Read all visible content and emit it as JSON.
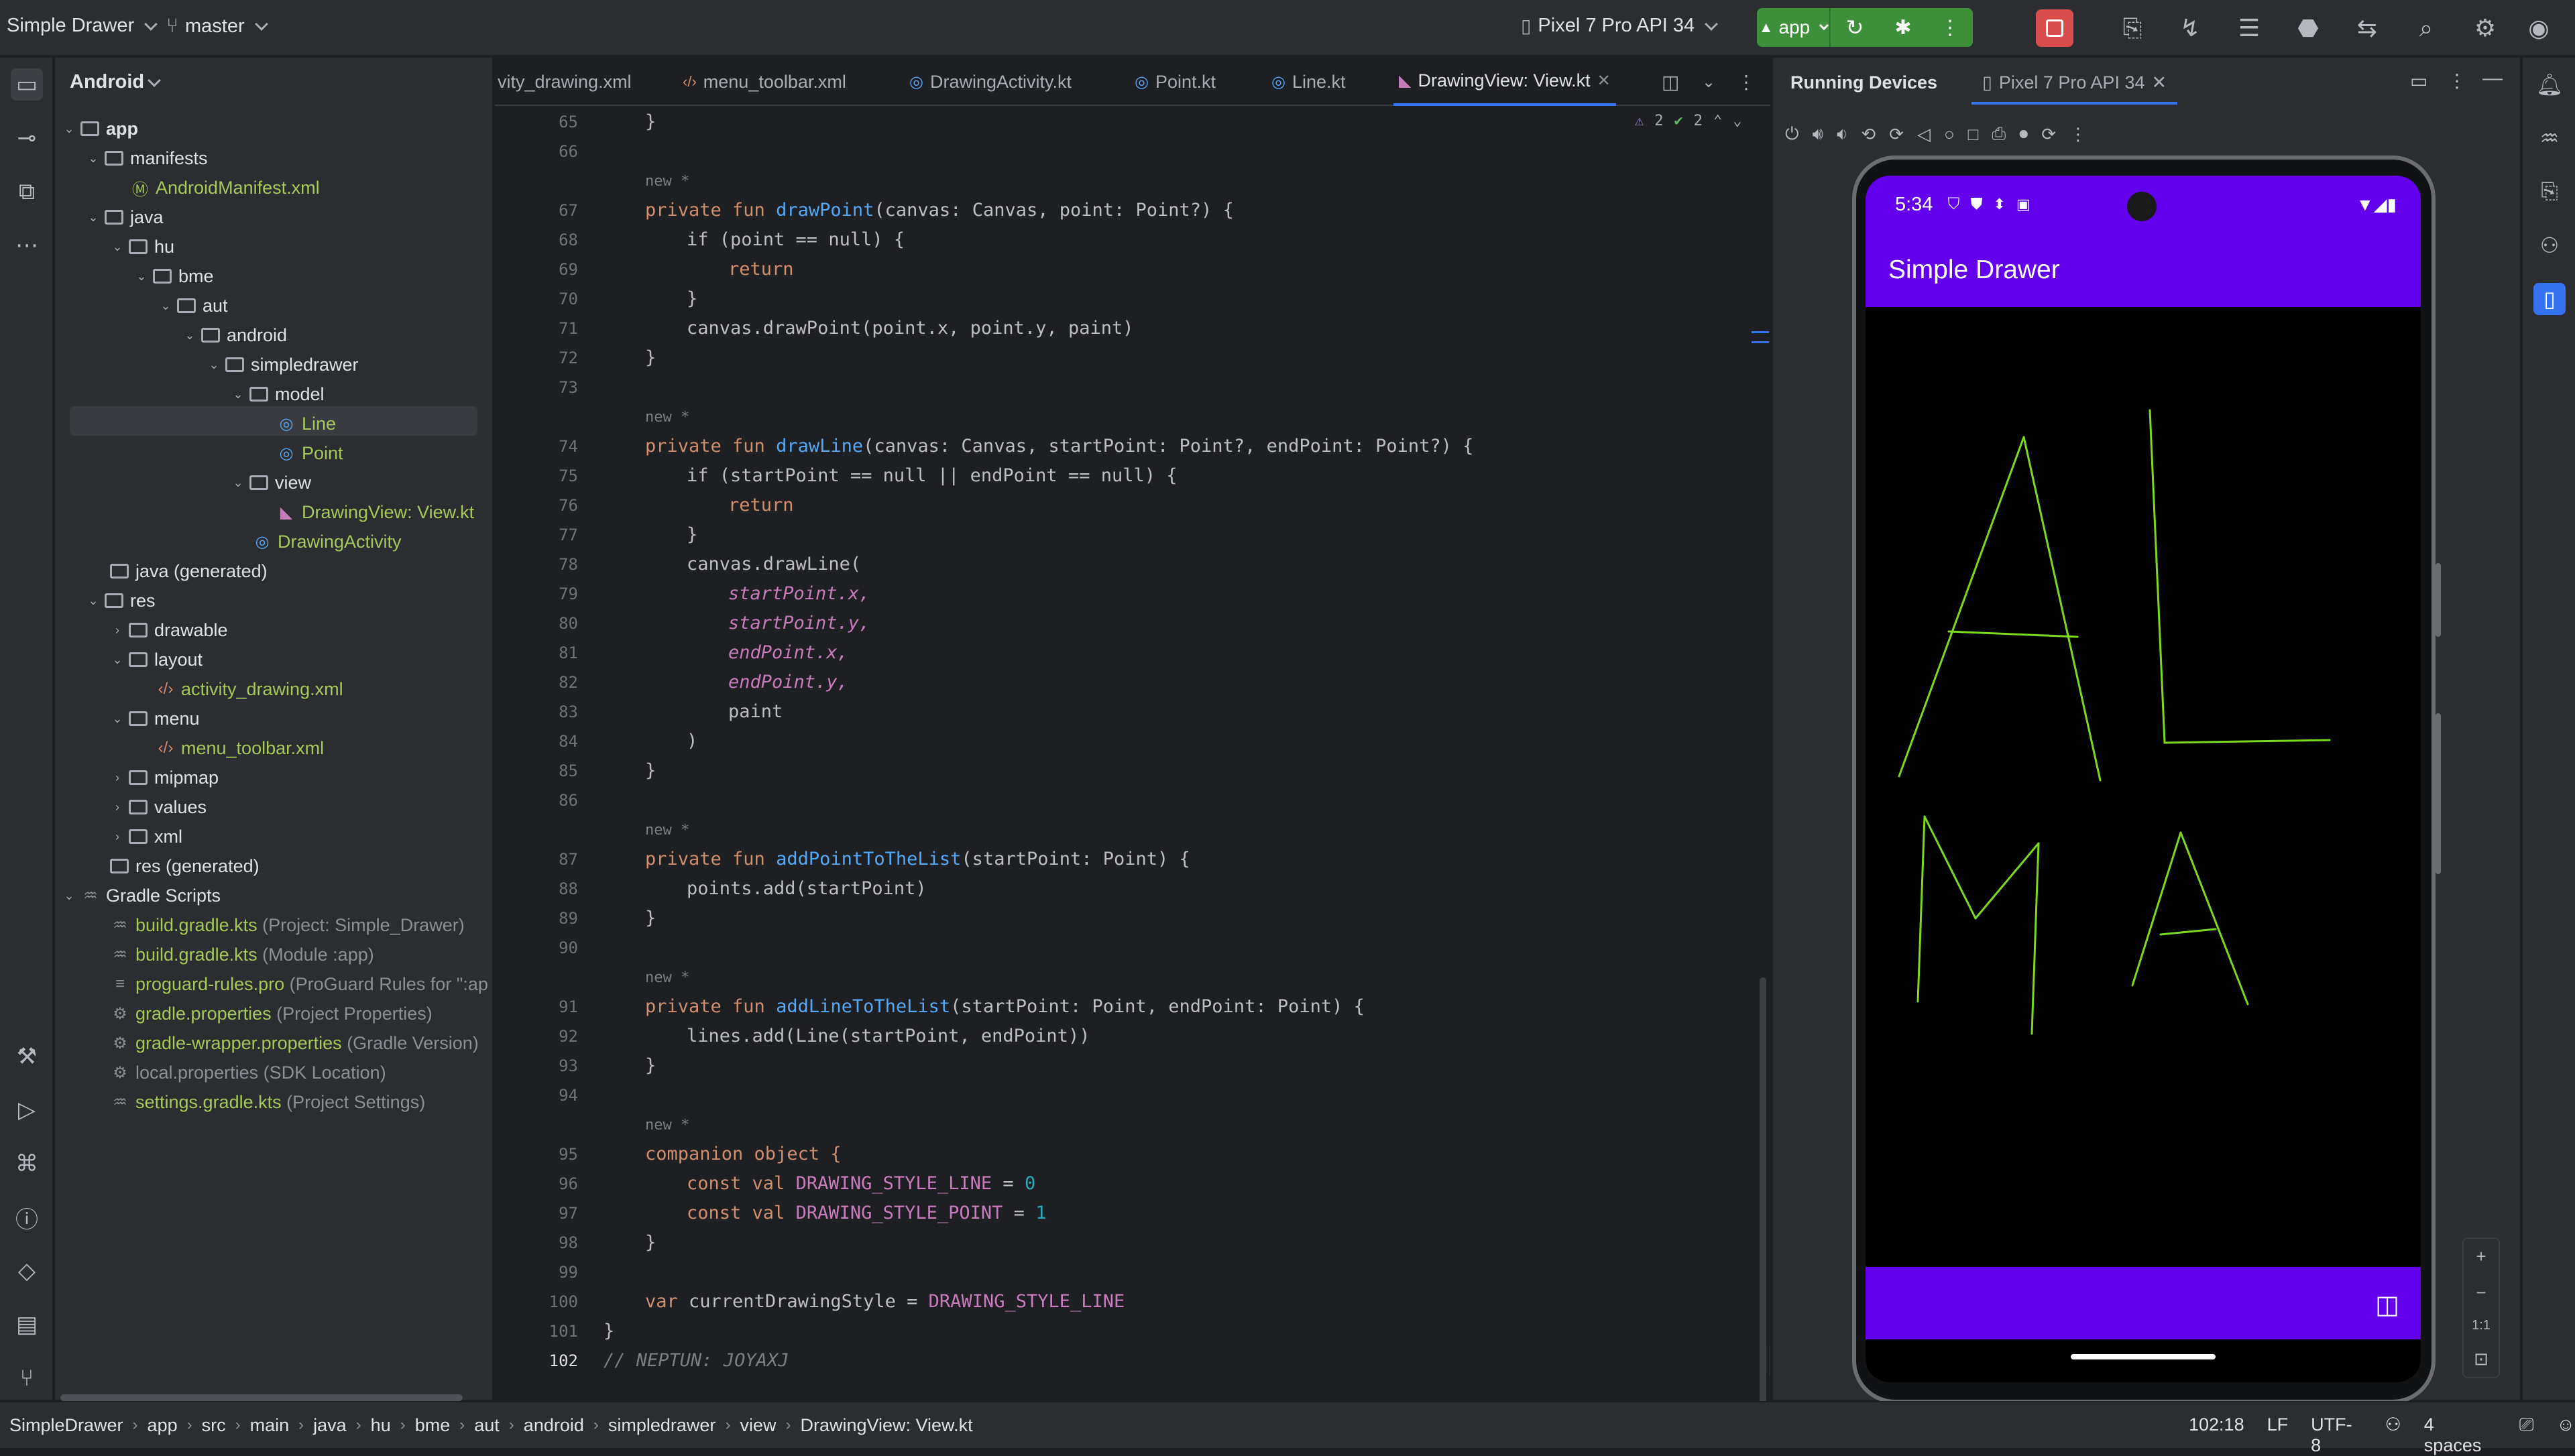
{
  "topbar": {
    "project": "Simple Drawer",
    "branch": "master",
    "device": "Pixel 7 Pro API 34",
    "run_config": "app"
  },
  "project_panel": {
    "view_mode": "Android",
    "tree": [
      {
        "label": "app",
        "bold": true
      },
      {
        "label": "manifests"
      },
      {
        "label": "AndroidManifest.xml"
      },
      {
        "label": "java"
      },
      {
        "label": "hu"
      },
      {
        "label": "bme"
      },
      {
        "label": "aut"
      },
      {
        "label": "android"
      },
      {
        "label": "simpledrawer"
      },
      {
        "label": "model"
      },
      {
        "label": "Line"
      },
      {
        "label": "Point"
      },
      {
        "label": "view"
      },
      {
        "label": "DrawingView: View.kt"
      },
      {
        "label": "DrawingActivity"
      },
      {
        "label": "java (generated)"
      },
      {
        "label": "res"
      },
      {
        "label": "drawable"
      },
      {
        "label": "layout"
      },
      {
        "label": "activity_drawing.xml"
      },
      {
        "label": "menu"
      },
      {
        "label": "menu_toolbar.xml"
      },
      {
        "label": "mipmap"
      },
      {
        "label": "values"
      },
      {
        "label": "xml"
      },
      {
        "label": "res (generated)"
      },
      {
        "label": "Gradle Scripts"
      },
      {
        "label": "build.gradle.kts",
        "note": "(Project: Simple_Drawer)"
      },
      {
        "label": "build.gradle.kts",
        "note": "(Module :app)"
      },
      {
        "label": "proguard-rules.pro",
        "note": "(ProGuard Rules for \":ap"
      },
      {
        "label": "gradle.properties",
        "note": "(Project Properties)"
      },
      {
        "label": "gradle-wrapper.properties",
        "note": "(Gradle Version)"
      },
      {
        "label": "local.properties",
        "note": "(SDK Location)"
      },
      {
        "label": "settings.gradle.kts",
        "note": "(Project Settings)"
      }
    ]
  },
  "editor": {
    "tabs": [
      "vity_drawing.xml",
      "menu_toolbar.xml",
      "DrawingActivity.kt",
      "Point.kt",
      "Line.kt",
      "DrawingView: View.kt"
    ],
    "warnings": "2",
    "checks": "2",
    "new_tag": "new *",
    "line_numbers": [
      "65",
      "66",
      "67",
      "68",
      "69",
      "70",
      "71",
      "72",
      "73",
      "74",
      "75",
      "76",
      "77",
      "78",
      "79",
      "80",
      "81",
      "82",
      "83",
      "84",
      "85",
      "86",
      "87",
      "88",
      "89",
      "90",
      "91",
      "92",
      "93",
      "94",
      "95",
      "96",
      "97",
      "98",
      "99",
      "100",
      "101",
      "102"
    ],
    "code": {
      "l65": "}",
      "l67_kw": "private fun ",
      "l67_fn": "drawPoint",
      "l67_rest": "(canvas: Canvas, point: Point?) {",
      "l68": "if (point == null) {",
      "l69": "return",
      "l70": "}",
      "l71": "canvas.drawPoint(point.x, point.y, paint)",
      "l72": "}",
      "l74_fn": "drawLine",
      "l74_rest": "(canvas: Canvas, startPoint: Point?, endPoint: Point?) {",
      "l75": "if (startPoint == null || endPoint == null) {",
      "l76": "return",
      "l77": "}",
      "l78": "canvas.drawLine(",
      "l79": "startPoint.x,",
      "l80": "startPoint.y,",
      "l81": "endPoint.x,",
      "l82": "endPoint.y,",
      "l83": "paint",
      "l84": ")",
      "l85": "}",
      "l87_fn": "addPointToTheList",
      "l87_rest": "(startPoint: Point) {",
      "l88": "points.add(startPoint)",
      "l89": "}",
      "l91_fn": "addLineToTheList",
      "l91_rest": "(startPoint: Point, endPoint: Point) {",
      "l92": "lines.add(Line(startPoint, endPoint))",
      "l93": "}",
      "l95": "companion object {",
      "l96_a": "const val ",
      "l96_b": "DRAWING_STYLE_LINE",
      "l96_c": " = ",
      "l96_d": "0",
      "l97_b": "DRAWING_STYLE_POINT",
      "l97_d": "1",
      "l98": "}",
      "l100_a": "var ",
      "l100_b": "currentDrawingStyle",
      "l100_c": " = ",
      "l100_d": "DRAWING_STYLE_LINE",
      "l101": "}",
      "l102": "// NEPTUN: JOYAXJ"
    }
  },
  "devices": {
    "panel_title": "Running Devices",
    "device_tab": "Pixel 7 Pro API 34",
    "zoom_label": "1:1"
  },
  "phone": {
    "time": "5:34",
    "app_title": "Simple Drawer",
    "stroke_color": "#7bd91f",
    "bar_color": "#6200ee"
  },
  "statusline": {
    "breadcrumbs": [
      "SimpleDrawer",
      "app",
      "src",
      "main",
      "java",
      "hu",
      "bme",
      "aut",
      "android",
      "simpledrawer",
      "view",
      "DrawingView: View.kt"
    ],
    "position": "102:18",
    "line_sep": "LF",
    "encoding": "UTF-8",
    "indent": "4 spaces"
  }
}
